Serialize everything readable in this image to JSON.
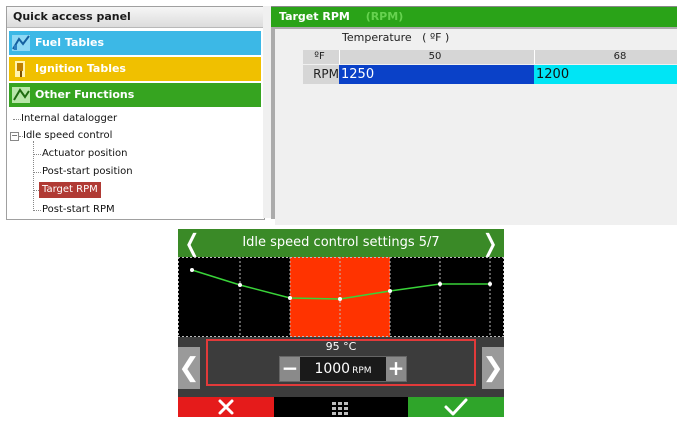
{
  "quick_access": {
    "title": "Quick access panel",
    "categories": [
      {
        "label": "Fuel Tables",
        "color": "#3cb8e6",
        "icon": "fuel-tables-icon"
      },
      {
        "label": "Ignition Tables",
        "color": "#f0c000",
        "icon": "ignition-tables-icon"
      },
      {
        "label": "Other Functions",
        "color": "#36a420",
        "icon": "other-functions-icon"
      }
    ],
    "tree": {
      "internal_datalogger": "Internal datalogger",
      "idle_speed_control": "Idle speed control",
      "children": [
        "Actuator position",
        "Post-start position",
        "Target RPM",
        "Post-start RPM"
      ],
      "selected": "Target RPM"
    }
  },
  "target_rpm": {
    "title": "Target RPM",
    "unit": "(RPM)",
    "temperature_header": "Temperature   ( ºF )",
    "corner_label": "ºF",
    "row_label": "RPM",
    "columns": [
      "50",
      "68"
    ],
    "values": [
      "1250",
      "1200"
    ],
    "cell_colors": [
      "#0a41c8",
      "#00e5f5"
    ]
  },
  "device": {
    "header": "Idle speed control settings 5/7",
    "prev_arrow": "❬",
    "next_arrow": "❭",
    "temperature_label": "95 °C",
    "value": "1000",
    "value_unit": "RPM",
    "minus": "−",
    "plus": "+",
    "left_arrow": "❮",
    "right_arrow": "❯",
    "colors": {
      "header": "#3a8a27",
      "highlight": "#ff3300",
      "line": "#39d339",
      "cancel": "#e51b1b",
      "ok": "#2fa52a"
    }
  }
}
